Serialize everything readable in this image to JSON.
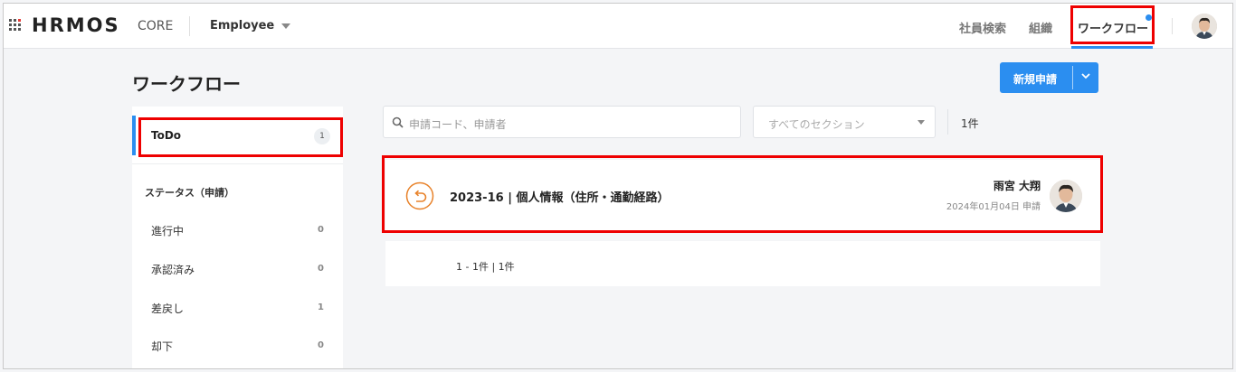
{
  "header": {
    "logo": "HRMOS",
    "product": "CORE",
    "switcher": "Employee",
    "nav": [
      "社員検索",
      "組織",
      "ワークフロー"
    ]
  },
  "page": {
    "title": "ワークフロー",
    "new_button": "新規申請"
  },
  "sidebar": {
    "todo": {
      "label": "ToDo",
      "count": "1"
    },
    "section_title": "ステータス（申請）",
    "items": [
      {
        "label": "進行中",
        "count": "0"
      },
      {
        "label": "承認済み",
        "count": "0"
      },
      {
        "label": "差戻し",
        "count": "1"
      },
      {
        "label": "却下",
        "count": "0"
      }
    ]
  },
  "filters": {
    "search_placeholder": "申請コード、申請者",
    "section_placeholder": "すべてのセクション",
    "result_count": "1件"
  },
  "requests": [
    {
      "title": "2023-16 | 個人情報（住所・通勤経路）",
      "applicant": "雨宮 大翔",
      "date": "2024年01月04日 申請",
      "status_icon": "return-arrow-icon",
      "status_color": "#e8822a"
    }
  ],
  "pagination": {
    "text": "1 - 1件 | 1件"
  },
  "colors": {
    "accent": "#2b8ef0",
    "highlight": "#e00000",
    "status_returned": "#e8822a"
  }
}
